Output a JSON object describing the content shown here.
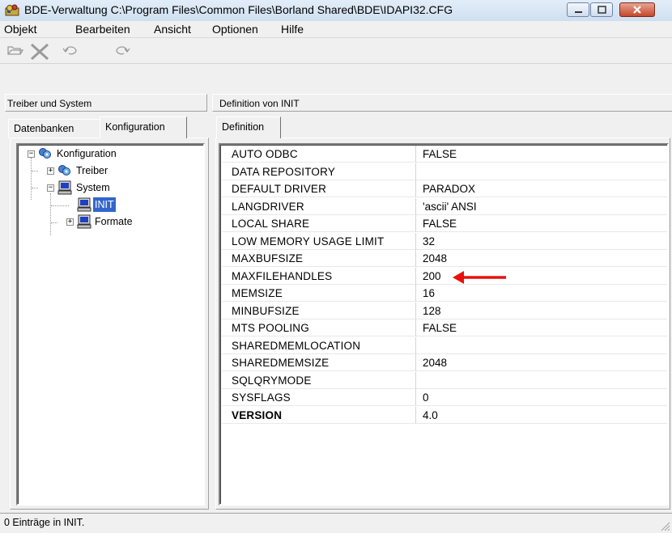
{
  "window": {
    "title": "BDE-Verwaltung  C:\\Program Files\\Common Files\\Borland Shared\\BDE\\IDAPI32.CFG"
  },
  "menu": [
    "Objekt",
    "Bearbeiten",
    "Ansicht",
    "Optionen",
    "Hilfe"
  ],
  "toolbar": {
    "icons": [
      "open-icon",
      "delete-icon",
      "undo-icon",
      "redo-icon"
    ]
  },
  "left_pane": {
    "header": "Treiber und System",
    "tabs": [
      "Datenbanken",
      "Konfiguration"
    ],
    "active_tab": "Konfiguration",
    "tree": [
      {
        "label": "Konfiguration",
        "expander": "−"
      },
      {
        "label": "Treiber",
        "expander": "+"
      },
      {
        "label": "System",
        "expander": "−"
      },
      {
        "label": "INIT",
        "expander": ""
      },
      {
        "label": "Formate",
        "expander": "+"
      }
    ],
    "selected": "INIT"
  },
  "right_pane": {
    "header": "Definition von INIT",
    "tab": "Definition",
    "rows": [
      {
        "name": "AUTO ODBC",
        "value": "FALSE"
      },
      {
        "name": "DATA REPOSITORY",
        "value": ""
      },
      {
        "name": "DEFAULT DRIVER",
        "value": "PARADOX"
      },
      {
        "name": "LANGDRIVER",
        "value": "'ascii' ANSI"
      },
      {
        "name": "LOCAL SHARE",
        "value": "FALSE"
      },
      {
        "name": "LOW MEMORY USAGE LIMIT",
        "value": "32"
      },
      {
        "name": "MAXBUFSIZE",
        "value": "2048"
      },
      {
        "name": "MAXFILEHANDLES",
        "value": "200"
      },
      {
        "name": "MEMSIZE",
        "value": "16"
      },
      {
        "name": "MINBUFSIZE",
        "value": "128"
      },
      {
        "name": "MTS POOLING",
        "value": "FALSE"
      },
      {
        "name": "SHAREDMEMLOCATION",
        "value": ""
      },
      {
        "name": "SHAREDMEMSIZE",
        "value": "2048"
      },
      {
        "name": "SQLQRYMODE",
        "value": ""
      },
      {
        "name": "SYSFLAGS",
        "value": "0"
      },
      {
        "name": "VERSION",
        "value": "4.0"
      }
    ],
    "annotation_color": "#e8100c"
  },
  "status": {
    "text": "0 Einträge in INIT."
  }
}
